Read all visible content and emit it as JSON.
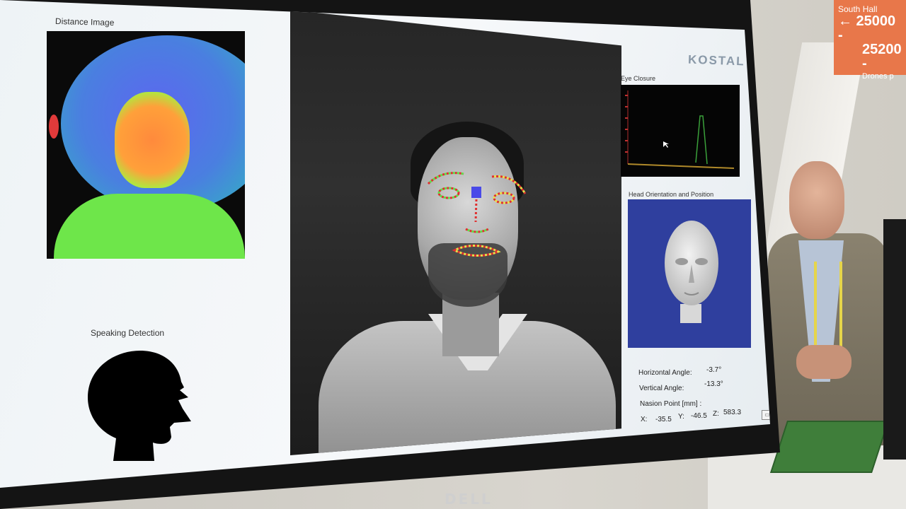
{
  "labels": {
    "distance_image": "Distance Image",
    "speaking_detection": "Speaking Detection",
    "eye_closure": "Eye Closure",
    "head_orientation": "Head Orientation and Position",
    "brand_logo": "KOSTAL"
  },
  "readout": {
    "horizontal_angle_label": "Horizontal Angle:",
    "horizontal_angle_value": "-3.7°",
    "vertical_angle_label": "Vertical Angle:",
    "vertical_angle_value": "-13.3°",
    "nasion_label": "Nasion Point [mm] :",
    "x_label": "X:",
    "x_value": "-35.5",
    "y_label": "Y:",
    "y_value": "-46.5",
    "z_label": "Z:",
    "z_value": "583.3"
  },
  "monitor": {
    "brand": "DELL"
  },
  "background_sign": {
    "line1": "South Hall",
    "line2": "← 25000 -",
    "line3": "25200 -",
    "line4": "Drones p"
  },
  "colors": {
    "depth_far": "#5d66f0",
    "depth_mid": "#3aa0cc",
    "depth_near": "#6ee64a",
    "depth_closest": "#ff8a3c",
    "landmark_red": "#e03030",
    "landmark_green": "#5ee04a",
    "landmark_yellow": "#e6e04a",
    "head_view_bg": "#2f3f9e",
    "sign_orange": "#e8774a"
  }
}
